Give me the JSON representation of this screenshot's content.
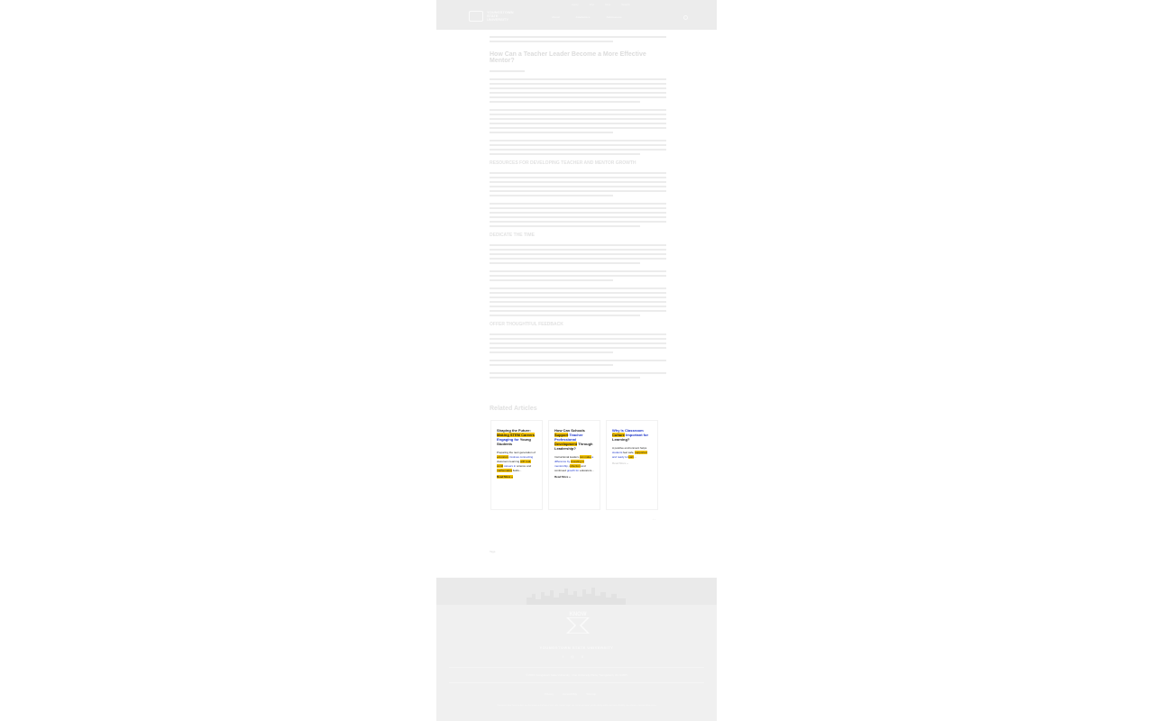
{
  "header": {
    "logo_text": "YOUNGSTOWN STATE UNIVERSITY",
    "util_nav": [
      "Apply",
      "Visit",
      "Give",
      "Search"
    ],
    "main_nav": [
      "About",
      "Academics",
      "Admissions"
    ]
  },
  "article": {
    "breadcrumb": "",
    "title": "How Can a Teacher Leader Become a More Effective Mentor?",
    "byline": "",
    "sections": [
      {
        "heading": "RESOURCES FOR DEVELOPING TEACHER AND MENTOR GROWTH"
      },
      {
        "heading": "DEDICATE THE TIME"
      },
      {
        "heading": "OFFER THOUGHTFUL FEEDBACK"
      }
    ]
  },
  "related": {
    "heading": "Related Articles",
    "cards": [
      {
        "title_parts": [
          "Shaping the Future: ",
          "Making STEM Careers",
          " Engaging for",
          " Young Students"
        ],
        "body_parts": [
          "Preparing the next generation of ",
          "educators",
          " involves connecting",
          " classroom learning ",
          "with real-world",
          " careers in",
          " science and ",
          "mathematics",
          " fields..."
        ],
        "read_more": "Read More »"
      },
      {
        "title_parts": [
          "How Can Schools ",
          "Support",
          " Teacher Professional",
          " Development",
          " Through Leadership?"
        ],
        "body_parts": [
          "Instructional leaders ",
          "can make",
          " a difference by ",
          "investing in",
          " mentorship, ",
          "reflection",
          " and continued",
          " growth for",
          " educators..."
        ],
        "read_more": "Read More »"
      },
      {
        "title_parts": [
          "Why Is Classroom ",
          "Culture",
          " Important for",
          " Learning?"
        ],
        "body_parts": [
          "A positive environment helps ",
          "students",
          " feel safe, ",
          "supported",
          " and ready to ",
          "learn",
          "..."
        ],
        "read_more": "Read More »"
      }
    ],
    "pager": "‹ ›"
  },
  "tag_label": "Tags",
  "footer": {
    "logo_text": "KNOW",
    "university": "YOUNGSTOWN STATE UNIVERSITY",
    "socials": [
      "f",
      "◎",
      "X"
    ],
    "address": "© 2024 Youngstown State University · One University Plaza, Youngstown, OH 44555",
    "links": [
      "Privacy",
      "Accessibility",
      "Sitemap"
    ],
    "note": "Youngstown State University does not discriminate on the basis of race, color, national origin, sex, sexual orientation, gender identity and/or expression, disability, age, religion or veteran/military status."
  }
}
